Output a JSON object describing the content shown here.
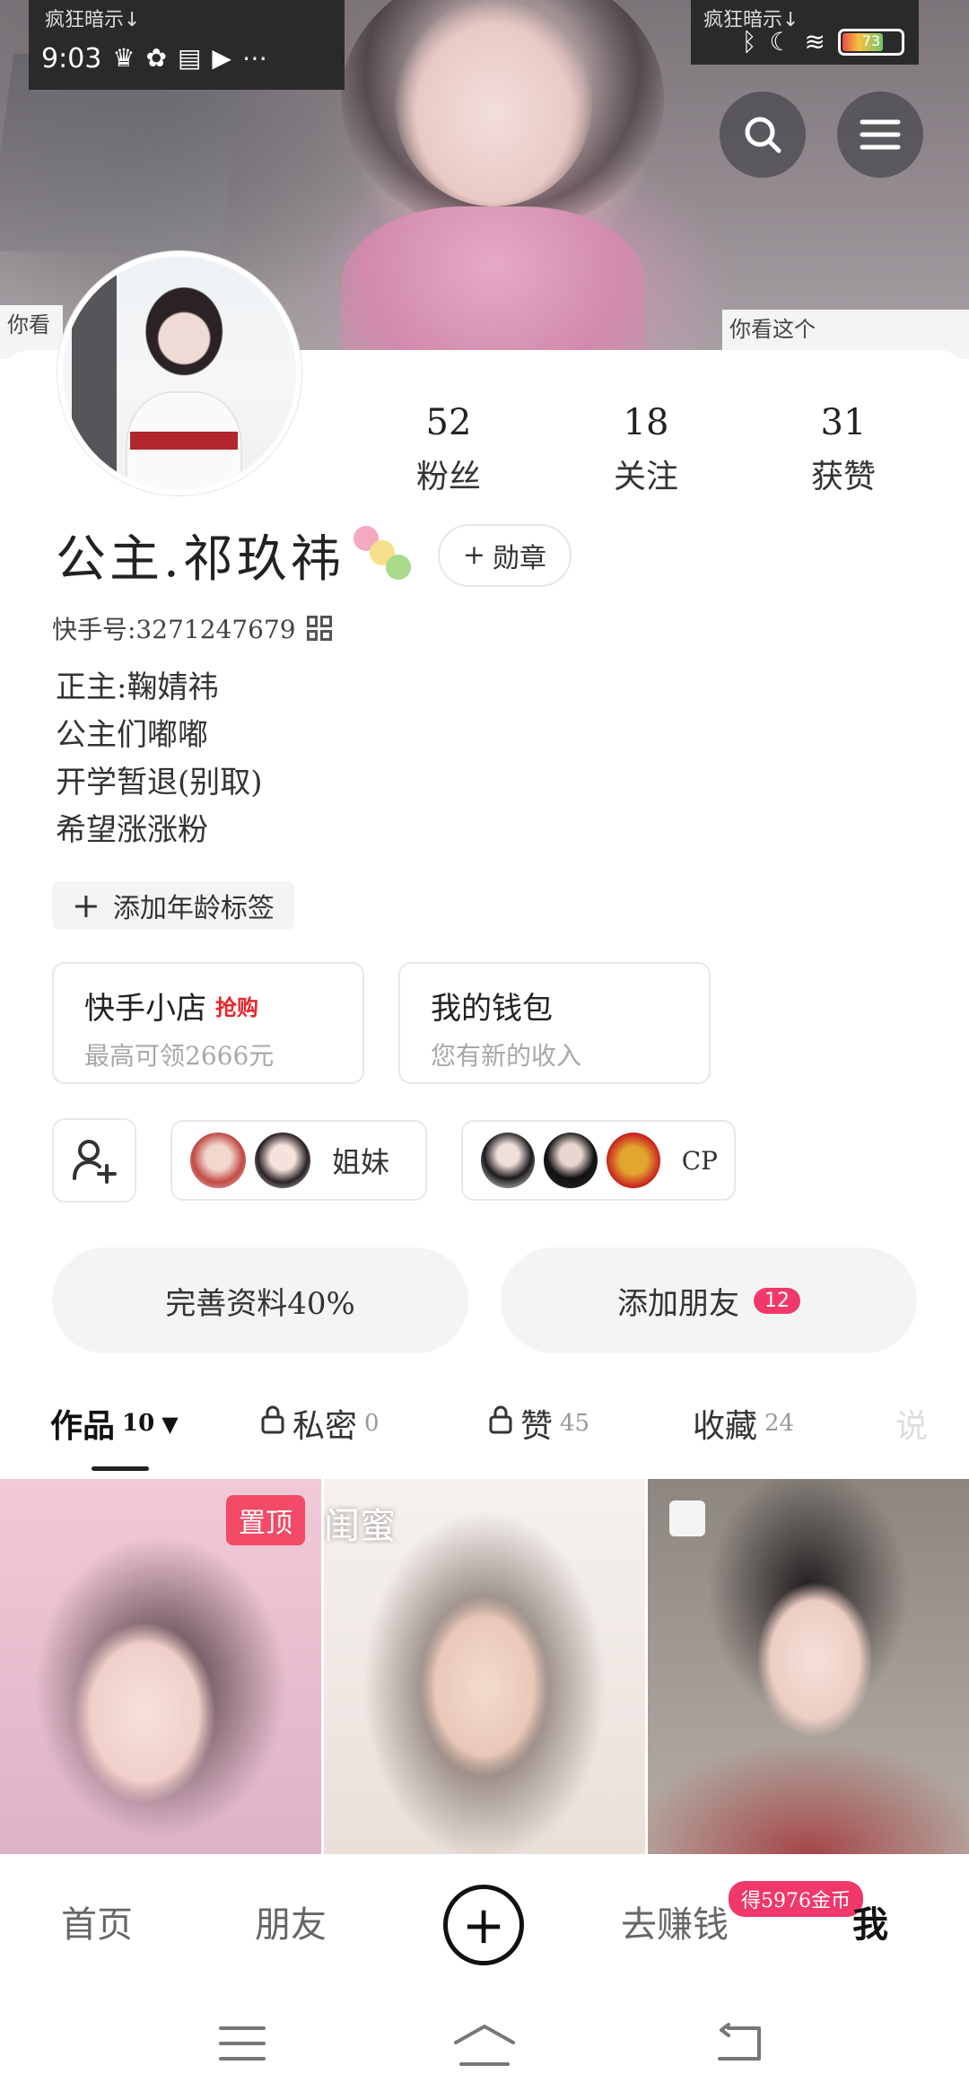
{
  "status_bar": {
    "time": "9:03",
    "sticker_left": "疯狂暗示↓",
    "sticker_right": "疯狂暗示↓",
    "battery": "73"
  },
  "cover": {
    "sticker_left": "你看",
    "sticker_right": "你看这个"
  },
  "profile": {
    "name": "公主.祁玖祎",
    "badge_label": "勋章",
    "kuaishou_id": "快手号:3271247679",
    "bio": [
      "正主:鞠婧祎",
      "公主们嘟嘟",
      "开学暂退(别取)",
      "希望涨涨粉"
    ],
    "age_tag": "添加年龄标签"
  },
  "stats": [
    {
      "value": "52",
      "label": "粉丝"
    },
    {
      "value": "18",
      "label": "关注"
    },
    {
      "value": "31",
      "label": "获赞"
    }
  ],
  "tiles": [
    {
      "title": "快手小店",
      "tag": "抢购",
      "subtitle": "最高可领2666元"
    },
    {
      "title": "我的钱包",
      "subtitle": "您有新的收入"
    }
  ],
  "groups": [
    {
      "label": "姐妹"
    },
    {
      "label": "CP"
    }
  ],
  "actions": {
    "complete_profile": "完善资料40%",
    "add_friends": "添加朋友",
    "add_friends_count": "12"
  },
  "tabs": [
    {
      "label": "作品",
      "count": "10"
    },
    {
      "label": "私密",
      "count": "0"
    },
    {
      "label": "赞",
      "count": "45"
    },
    {
      "label": "收藏",
      "count": "24"
    },
    {
      "label": "说"
    }
  ],
  "thumbnails": [
    {
      "pin_label": "置顶"
    },
    {
      "overlay_text": "闺蜜"
    },
    {}
  ],
  "bottom_nav": {
    "home": "首页",
    "friends": "朋友",
    "earn": "去赚钱",
    "me": "我",
    "coin_badge": "得5976金币"
  },
  "colors": {
    "accent_pink": "#f0386b",
    "pin_pink": "#f24a67",
    "shop_red": "#e8262c"
  }
}
